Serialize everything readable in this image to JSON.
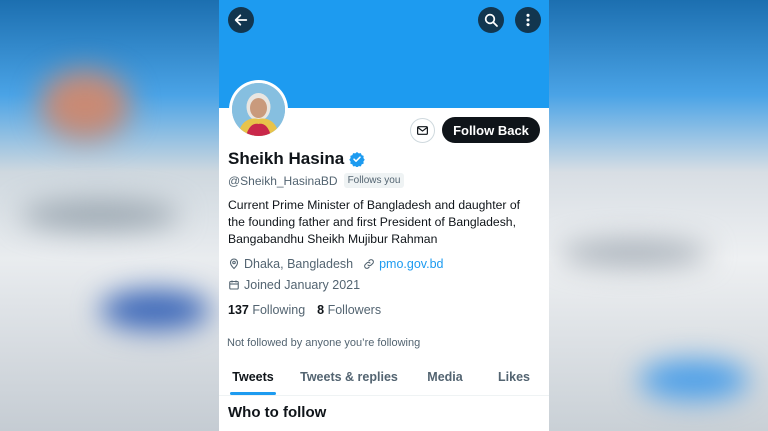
{
  "header": {
    "back_icon": "arrow-left-icon",
    "search_icon": "search-icon",
    "more_icon": "more-vertical-icon"
  },
  "profile": {
    "name": "Sheikh Hasina",
    "verified_icon": "verified-badge-icon",
    "handle": "@Sheikh_HasinaBD",
    "follows_you": "Follows you",
    "bio_lines": [
      "Current Prime Minister of Bangladesh and daughter of",
      "the founding father and first President of Bangladesh,",
      "Bangabandhu Sheikh Mujibur Rahman"
    ],
    "location": "Dhaka, Bangladesh",
    "website": "pmo.gov.bd",
    "joined": "Joined January 2021",
    "following_count": "137",
    "following_label": "Following",
    "followers_count": "8",
    "followers_label": "Followers",
    "not_followed_text": "Not followed by anyone you’re following"
  },
  "actions": {
    "message_icon": "mail-icon",
    "follow_back_label": "Follow Back"
  },
  "tabs": [
    {
      "label": "Tweets",
      "active": true
    },
    {
      "label": "Tweets & replies",
      "active": false
    },
    {
      "label": "Media",
      "active": false
    },
    {
      "label": "Likes",
      "active": false
    }
  ],
  "who_to_follow": {
    "title": "Who to follow"
  },
  "colors": {
    "accent": "#1d9bf0",
    "banner": "#1d9bf0",
    "text_primary": "#0f1419",
    "text_secondary": "#536471",
    "follow_button_bg": "#0f1419"
  }
}
